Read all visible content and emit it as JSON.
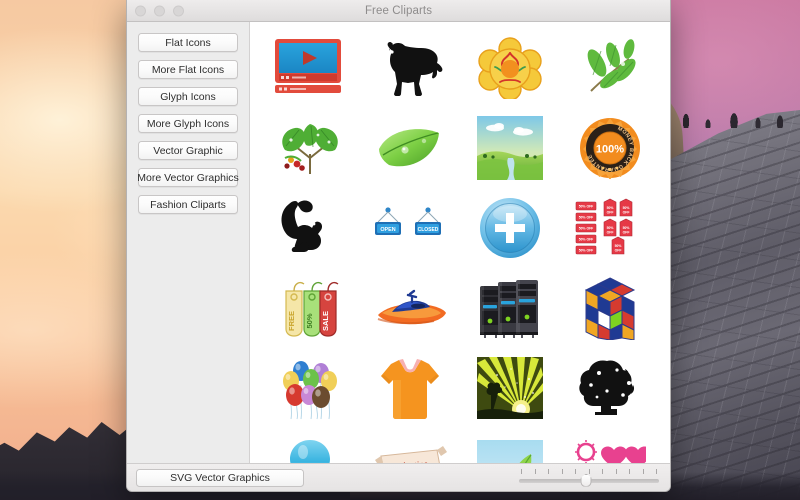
{
  "window": {
    "title": "Free Cliparts",
    "traffic_lights": [
      "close-button",
      "minimize-button",
      "zoom-button"
    ]
  },
  "sidebar": {
    "items": [
      {
        "label": "Flat Icons"
      },
      {
        "label": "More Flat Icons"
      },
      {
        "label": "Glyph Icons"
      },
      {
        "label": "More Glyph Icons"
      },
      {
        "label": "Vector Graphic"
      },
      {
        "label": "More Vector Graphics"
      },
      {
        "label": "Fashion Cliparts"
      }
    ]
  },
  "bottom_bar": {
    "button_label": "SVG Vector Graphics",
    "slider": {
      "ticks": 11,
      "value_percent": 48
    }
  },
  "gallery": {
    "columns": 4,
    "items": [
      {
        "name": "video-player-clipart",
        "label": "Video player with play button"
      },
      {
        "name": "dog-silhouette-clipart",
        "label": "Black dog silhouette"
      },
      {
        "name": "floral-mandala-clipart",
        "label": "Yellow orange floral mandala"
      },
      {
        "name": "leaf-branch-clipart",
        "label": "Green leaf branch"
      },
      {
        "name": "leafy-berry-branch-clipart",
        "label": "Leafy branch with berries"
      },
      {
        "name": "single-leaf-clipart",
        "label": "Single green leaf with dew"
      },
      {
        "name": "landscape-scene-clipart",
        "label": "Green landscape with river"
      },
      {
        "name": "money-back-badge-clipart",
        "label": "MONEY BACK GUARANTEE 100%",
        "badge_text": "MONEY BACK GUARANTEE",
        "badge_value": "100%"
      },
      {
        "name": "squirrel-silhouette-clipart",
        "label": "Black squirrel silhouette"
      },
      {
        "name": "open-closed-signs-clipart",
        "label": "OPEN and CLOSED signs",
        "sign_open": "OPEN",
        "sign_closed": "CLOSED"
      },
      {
        "name": "blue-plus-button-clipart",
        "label": "Blue glossy plus button"
      },
      {
        "name": "red-sale-tags-clipart",
        "label": "Red discount sale tags",
        "tag_text": "50% OFF"
      },
      {
        "name": "price-tags-clipart",
        "label": "Price tags free, fifty percent, sale",
        "tag1": "FREE",
        "tag2": "50%",
        "tag3": "SALE"
      },
      {
        "name": "jet-ski-clipart",
        "label": "Orange and blue jet ski"
      },
      {
        "name": "server-rack-clipart",
        "label": "Black server racks"
      },
      {
        "name": "rubiks-cube-clipart",
        "label": "Colorful Rubik's cube"
      },
      {
        "name": "balloons-clipart",
        "label": "Bunch of colorful balloons"
      },
      {
        "name": "tshirt-clipart",
        "label": "Orange t-shirt"
      },
      {
        "name": "sunburst-landscape-clipart",
        "label": "Yellow sunburst with tree"
      },
      {
        "name": "tree-silhouette-clipart",
        "label": "Black tree silhouette"
      },
      {
        "name": "blue-bulb-clipart",
        "label": "Blue glossy bulb shape"
      },
      {
        "name": "valentine-banner-clipart",
        "label": "Valentine ribbon banner",
        "banner_text": "Valentine"
      },
      {
        "name": "blue-leaf-scene-clipart",
        "label": "Blue scene with green leaf"
      },
      {
        "name": "heart-shapes-clipart",
        "label": "Pink and yellow heart outlines"
      }
    ]
  },
  "colors": {
    "window_chrome": "#ececec",
    "title_text": "#8e8c8c",
    "gallery_bg": "#ffffff",
    "accent_blue": "#1f9bd4",
    "accent_red": "#e0352b",
    "accent_orange": "#f59324",
    "accent_green": "#6cc24a"
  }
}
